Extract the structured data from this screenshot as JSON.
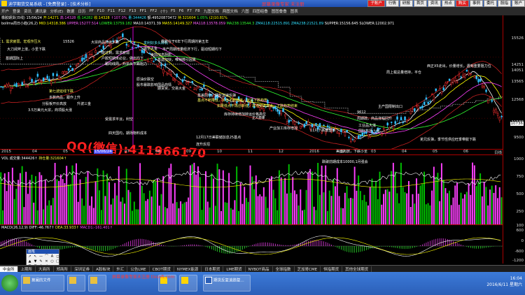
{
  "window": {
    "title": "迪学期货交易系统 - [免费登录] - [技术分析]",
    "watermark_top": "屏幕录像专家 未注册",
    "top_buttons": [
      "子账户",
      "行情",
      "研报",
      "首页",
      "资讯",
      "热点",
      "购买",
      "事例",
      "委托",
      "股指",
      "账户"
    ],
    "red_buttons": [
      "子账户",
      "购买"
    ]
  },
  "toolbar": {
    "items": [
      "开户",
      "登录",
      "资讯",
      "通讯录",
      "分析(E)",
      "数据",
      "日历",
      "PF",
      "F10",
      "F11",
      "F12",
      "F13",
      "FF1",
      "FF2",
      "(十)",
      "F5",
      "F6",
      "F7",
      "F8",
      "九图文档",
      "两图文档",
      "六图",
      "四图组叠",
      "图图叠叠",
      "图表"
    ]
  },
  "info_line1": {
    "symbol": "橡胶期货(日线)",
    "date": "15/06/24",
    "open": "开:14271",
    "high": "高:14328",
    "low": "低:14282",
    "close": "收:14328",
    "change": "↑107.0%",
    "vol": "量:344426",
    "amt": "额:49520873472",
    "hold": "持:321604",
    "pct": "1.05%",
    "extra": "(2)10.81%"
  },
  "info_line2": {
    "indicator": "bollma周日小趋(26,2)",
    "mid": "MID:14318.386",
    "upper": "UPPER:15277.514",
    "lower": "LOWER:13759.182",
    "ma10": "MA10:14371.39",
    "ma55": "MA55:14149.327",
    "ma118": "MA118:13578.059",
    "ma238": "MA238:13544.3",
    "zma": "ZMA118:22515.891",
    "zma2": "ZMA238:21521.89",
    "super": "SUPPER:15156.645",
    "slower": "SLOWER:12002.971"
  },
  "axis": {
    "price_labels": [
      "15526",
      "14251",
      "14051",
      "13565",
      "12568",
      "11588",
      "10736",
      "9500"
    ],
    "highlight_price": "10736",
    "vol_labels": [
      "1000",
      "750",
      "500",
      "250",
      "100"
    ],
    "macd_labels": [
      "600",
      "0",
      "-600",
      "-1200"
    ],
    "time_labels": [
      "2015",
      "04",
      "05",
      "15/06/24",
      "07",
      "08",
      "09",
      "10",
      "11",
      "12",
      "2016",
      "02",
      "03",
      "04",
      "05",
      "06"
    ],
    "highlight_time": "15/06/24",
    "right_end": "日线"
  },
  "vol_panel": {
    "label": "VOL 成交量:344426↑",
    "hold": "持仓量:321604↑"
  },
  "macd_panel": {
    "label": "MACD(26,12,9)",
    "diff": "DIFF:-46.767↑",
    "dea": "DEA:33.933↑",
    "macd": "MACD1:-161.401↑"
  },
  "annotations": [
    {
      "text": "1. 需求疲弱，宏观作压大",
      "color": "y"
    },
    {
      "text": "大刀阔斧上涨，小圣下跌",
      "color": "w"
    },
    {
      "text": "15526",
      "color": "w"
    },
    {
      "text": "大宗商品持续下跌",
      "color": "w"
    },
    {
      "text": "产能过剩，需求疲弱",
      "color": "w"
    },
    {
      "text": "户胶短期未必业，做出均下",
      "color": "w"
    },
    {
      "text": "跟均线周，升日头下跌阻力",
      "color": "w"
    },
    {
      "text": "发利好多头转机",
      "color": "c"
    },
    {
      "text": "做空大金",
      "color": "w"
    },
    {
      "text": "美国加息阴影",
      "color": "w"
    },
    {
      "text": "基建加快，唯稍微引因素",
      "color": "w"
    },
    {
      "text": "橡胶在于6年下行周期的第五年",
      "color": "w"
    },
    {
      "text": "丰产周期增量经济下行，驱动短期均下",
      "color": "w"
    },
    {
      "text": "第七波延线下跌",
      "color": "y"
    },
    {
      "text": "多数商品，跟作上升",
      "color": "w"
    },
    {
      "text": "分股板开价高放",
      "color": "w"
    },
    {
      "text": "3.5万美元大宗，商项股大涨",
      "color": "w"
    },
    {
      "text": "升波三金",
      "color": "w"
    },
    {
      "text": "原油价跌空",
      "color": "w"
    },
    {
      "text": "股市暴跌影响国品商情",
      "color": "w"
    },
    {
      "text": "期货资，交易大金",
      "color": "w"
    },
    {
      "text": "受需求平淡，利空",
      "color": "w"
    },
    {
      "text": "四天国均，期场物料成本",
      "color": "w"
    },
    {
      "text": "基差回归，期价加速反弹",
      "color": "w"
    },
    {
      "text": "基点不断降低，价点不断降低，就是下跌趋势",
      "color": "y"
    },
    {
      "text": "如果低点不再创新低，高点突破高点：下跌趋势结束",
      "color": "y"
    },
    {
      "text": "库存持续增加转运价格高位",
      "color": "w"
    },
    {
      "text": "正X波峰",
      "color": "w"
    },
    {
      "text": "产业加工库存增加",
      "color": "w"
    },
    {
      "text": "11月下跌散盘来",
      "color": "w"
    },
    {
      "text": "12月17日美联储加息25基点",
      "color": "w"
    },
    {
      "text": "连升反招",
      "color": "w"
    },
    {
      "text": "跌破前期成本10000,1月强会",
      "color": "w"
    },
    {
      "text": "美国周旅，下跌小圣",
      "color": "w"
    },
    {
      "text": "9612",
      "color": "w"
    },
    {
      "text": "周期疏，商品涨幅回升",
      "color": "w"
    },
    {
      "text": "工业品大涨",
      "color": "w"
    },
    {
      "text": "国际市场上涨",
      "color": "w"
    },
    {
      "text": "主产国限制出口",
      "color": "w"
    },
    {
      "text": "周上载总量增持，平仓",
      "color": "w"
    },
    {
      "text": "西正X5走出，价量增长，遇到重要阻力位",
      "color": "w"
    },
    {
      "text": "羌兄反弹，季节性供应旺季带胶下跌",
      "color": "w"
    },
    {
      "text": "基期国际上",
      "color": "w"
    },
    {
      "text": "QQ(微信):411966170",
      "color": "r"
    }
  ],
  "toolbox": {
    "title": "画笔",
    "tools": [
      "↗",
      "↖",
      "—",
      "⌒",
      "A",
      "◻",
      "▲",
      "▼",
      "✎",
      "✕",
      "○",
      "□",
      "☺",
      "☹",
      "⊙",
      "∠",
      "⋯",
      "⌂"
    ]
  },
  "bottom_tabs": [
    "中金所",
    "上期所",
    "大商所",
    "郑商所",
    "深圳证券",
    "A股板块",
    "外汇",
    "公告LME",
    "CBOT期货",
    "NYMEX能源",
    "日本期货",
    "LME期货",
    "NYBOT商品",
    "全球指数",
    "芝加哥CME",
    "恒指期货",
    "其他全球期货"
  ],
  "active_tab": "中金所",
  "taskbar": {
    "items": [
      "莫阑的文件",
      "",
      "",
      "",
      "",
      "期货反复追趋复..."
    ],
    "clock_time": "16:04",
    "clock_date": "2016/6/11 星期六",
    "watermark_bottom": "屏幕录像专家未注册 tlxsoft.com"
  },
  "colors": {
    "bull_candle": "#ff3030",
    "bear_candle": "#30c0ff",
    "ma_white": "#ffffff",
    "ma_yellow": "#ffff00",
    "ma_magenta": "#ff40ff",
    "ma_green": "#30ff30",
    "boll_red": "#c02020",
    "vol_green": "#00c000",
    "vol_magenta": "#ff40ff"
  },
  "chart_data": {
    "type": "candlestick",
    "title": "橡胶期货(日线)",
    "x_range": [
      "2015-01",
      "2016-06"
    ],
    "ylim": [
      9500,
      15600
    ],
    "price_path": [
      {
        "x": "2015-01",
        "close": 12600
      },
      {
        "x": "2015-02",
        "close": 12900
      },
      {
        "x": "2015-03",
        "close": 13200
      },
      {
        "x": "2015-04",
        "close": 14300
      },
      {
        "x": "2015-05",
        "close": 15300
      },
      {
        "x": "2015-06",
        "close": 14328
      },
      {
        "x": "2015-07",
        "close": 13100
      },
      {
        "x": "2015-08",
        "close": 12300
      },
      {
        "x": "2015-09",
        "close": 11700
      },
      {
        "x": "2015-10",
        "close": 11600
      },
      {
        "x": "2015-11",
        "close": 10600
      },
      {
        "x": "2015-12",
        "close": 10300
      },
      {
        "x": "2016-01",
        "close": 9800
      },
      {
        "x": "2016-02",
        "close": 10200
      },
      {
        "x": "2016-03",
        "close": 11200
      },
      {
        "x": "2016-04",
        "close": 12500
      },
      {
        "x": "2016-05",
        "close": 13600
      },
      {
        "x": "2016-06",
        "close": 10736
      }
    ]
  }
}
